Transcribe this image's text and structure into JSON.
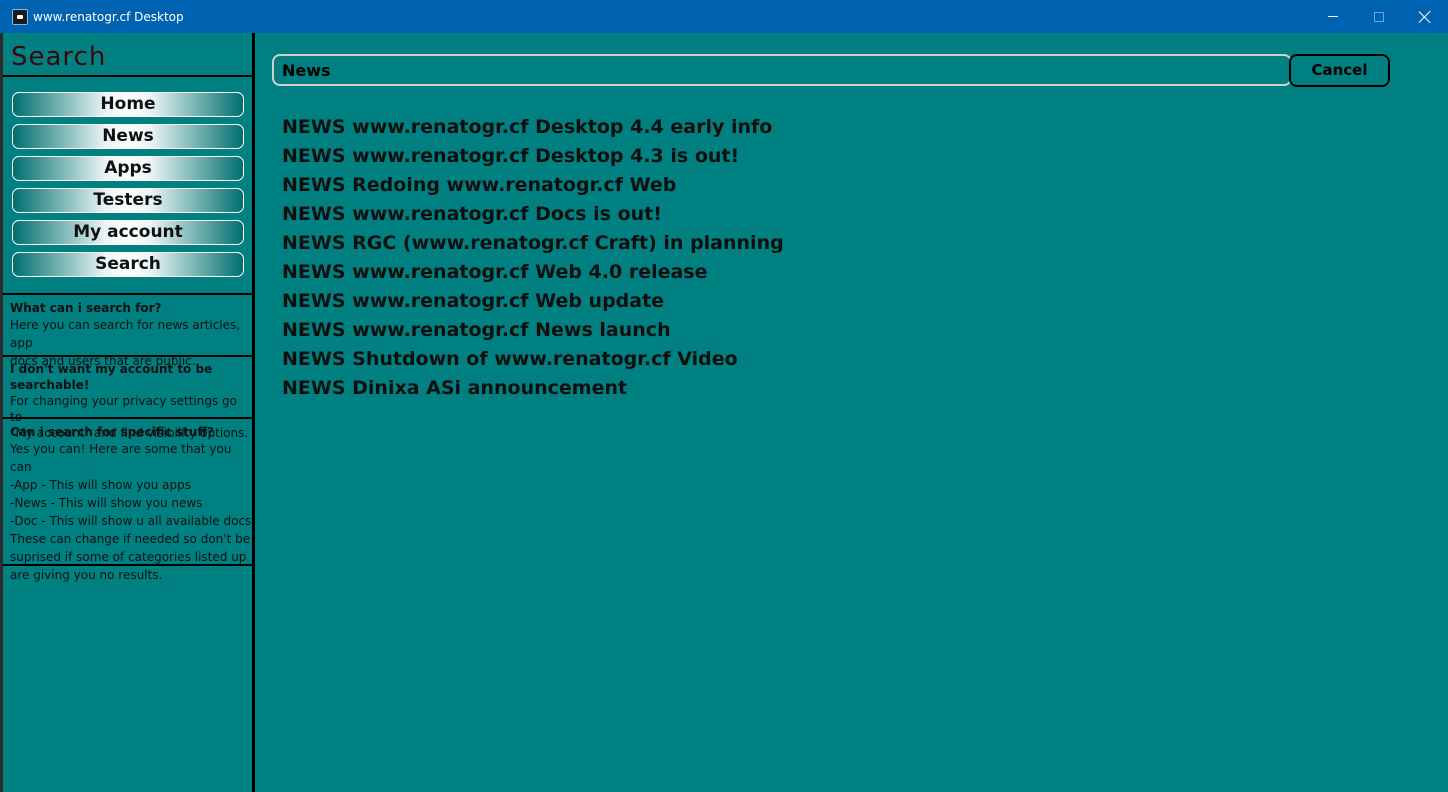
{
  "window": {
    "title": "www.renatogr.cf Desktop",
    "icon": "app-logo-icon",
    "controls": [
      "minimize-icon",
      "maximize-icon",
      "close-icon"
    ]
  },
  "sidebar": {
    "title": "Search",
    "nav": [
      "Home",
      "News",
      "Apps",
      "Testers",
      "My account",
      "Search"
    ],
    "faq": [
      {
        "question": "What can i search for?",
        "answer": "Here you can search for news articles, app\ndocs and users that are public."
      },
      {
        "question": "I don't want my account to be searchable!",
        "answer": "For changing your privacy settings go to\n\"My account\" and find visibility options."
      },
      {
        "question": "Can i search for specific stuff?",
        "answer": "Yes you can! Here are some that you can\n-App - This will show you apps\n-News - This will show you  news\n-Doc - This will show u all available docs\nThese can change if needed so don't be\nsuprised if some of categories listed up\nare giving you no results."
      }
    ]
  },
  "search": {
    "value": "News",
    "cancel_label": "Cancel"
  },
  "results": [
    "NEWS www.renatogr.cf Desktop 4.4 early info",
    "NEWS www.renatogr.cf Desktop 4.3 is out!",
    "NEWS Redoing www.renatogr.cf Web",
    "NEWS www.renatogr.cf Docs is out!",
    "NEWS RGC (www.renatogr.cf Craft) in planning",
    "NEWS www.renatogr.cf Web 4.0 release",
    "NEWS www.renatogr.cf Web update",
    "NEWS www.renatogr.cf News launch",
    "NEWS Shutdown of www.renatogr.cf Video",
    "NEWS Dinixa ASi announcement"
  ],
  "colors": {
    "titlebar": "#0063b1",
    "background": "#008080",
    "border": "#000000"
  }
}
